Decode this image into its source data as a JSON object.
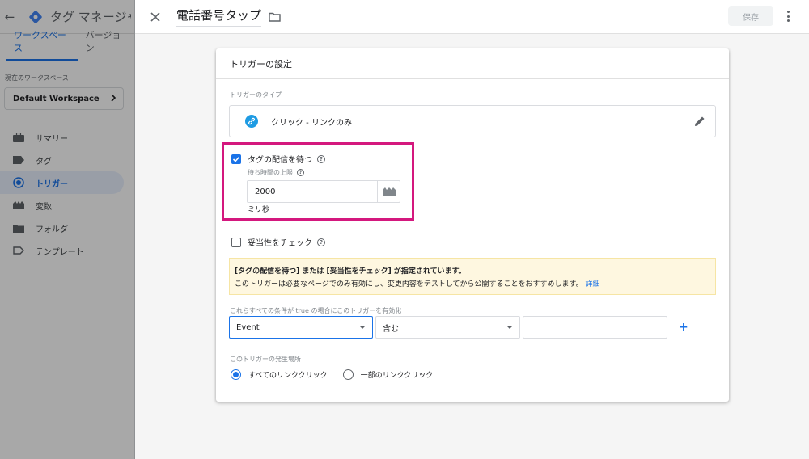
{
  "sidebar": {
    "app_title": "タグ マネージャー",
    "tabs": [
      {
        "label": "ワークスペース",
        "active": true
      },
      {
        "label": "バージョン",
        "active": false
      }
    ],
    "workspace_label": "現在のワークスペース",
    "workspace_name": "Default Workspace",
    "nav": [
      {
        "label": "サマリー",
        "icon": "briefcase-icon",
        "active": false
      },
      {
        "label": "タグ",
        "icon": "tag-icon",
        "active": false
      },
      {
        "label": "トリガー",
        "icon": "trigger-icon",
        "active": true
      },
      {
        "label": "変数",
        "icon": "variables-icon",
        "active": false
      },
      {
        "label": "フォルダ",
        "icon": "folder-icon",
        "active": false
      },
      {
        "label": "テンプレート",
        "icon": "template-icon",
        "active": false
      }
    ]
  },
  "header": {
    "trigger_name": "電話番号タップ",
    "save_label": "保存"
  },
  "card": {
    "title": "トリガーの設定",
    "type_label": "トリガーのタイプ",
    "type_name": "クリック - リンクのみ",
    "wait_for_tags": {
      "checked": true,
      "label": "タグの配信を待つ",
      "max_wait_label": "待ち時間の上限",
      "max_wait_value": "2000",
      "unit": "ミリ秒"
    },
    "check_validation": {
      "checked": false,
      "label": "妥当性をチェック"
    },
    "notice": {
      "line1": "[タグの配信を待つ] または [妥当性をチェック] が指定されています。",
      "line2": "このトリガーは必要なページでのみ有効にし、変更内容をテストしてから公開することをおすすめします。",
      "link": "詳細"
    },
    "condition_label": "これらすべての条件が true の場合にこのトリガーを有効化",
    "condition": {
      "variable": "Event",
      "operator": "含む",
      "value": "",
      "add": "+"
    },
    "fire_on_label": "このトリガーの発生場所",
    "fire_on_options": [
      {
        "label": "すべてのリンククリック",
        "selected": true
      },
      {
        "label": "一部のリンククリック",
        "selected": false
      }
    ]
  },
  "colors": {
    "accent": "#1a73e8",
    "highlight": "#d4187e",
    "notice_bg": "#fef7e0",
    "link_icon": "#1e9be3"
  }
}
